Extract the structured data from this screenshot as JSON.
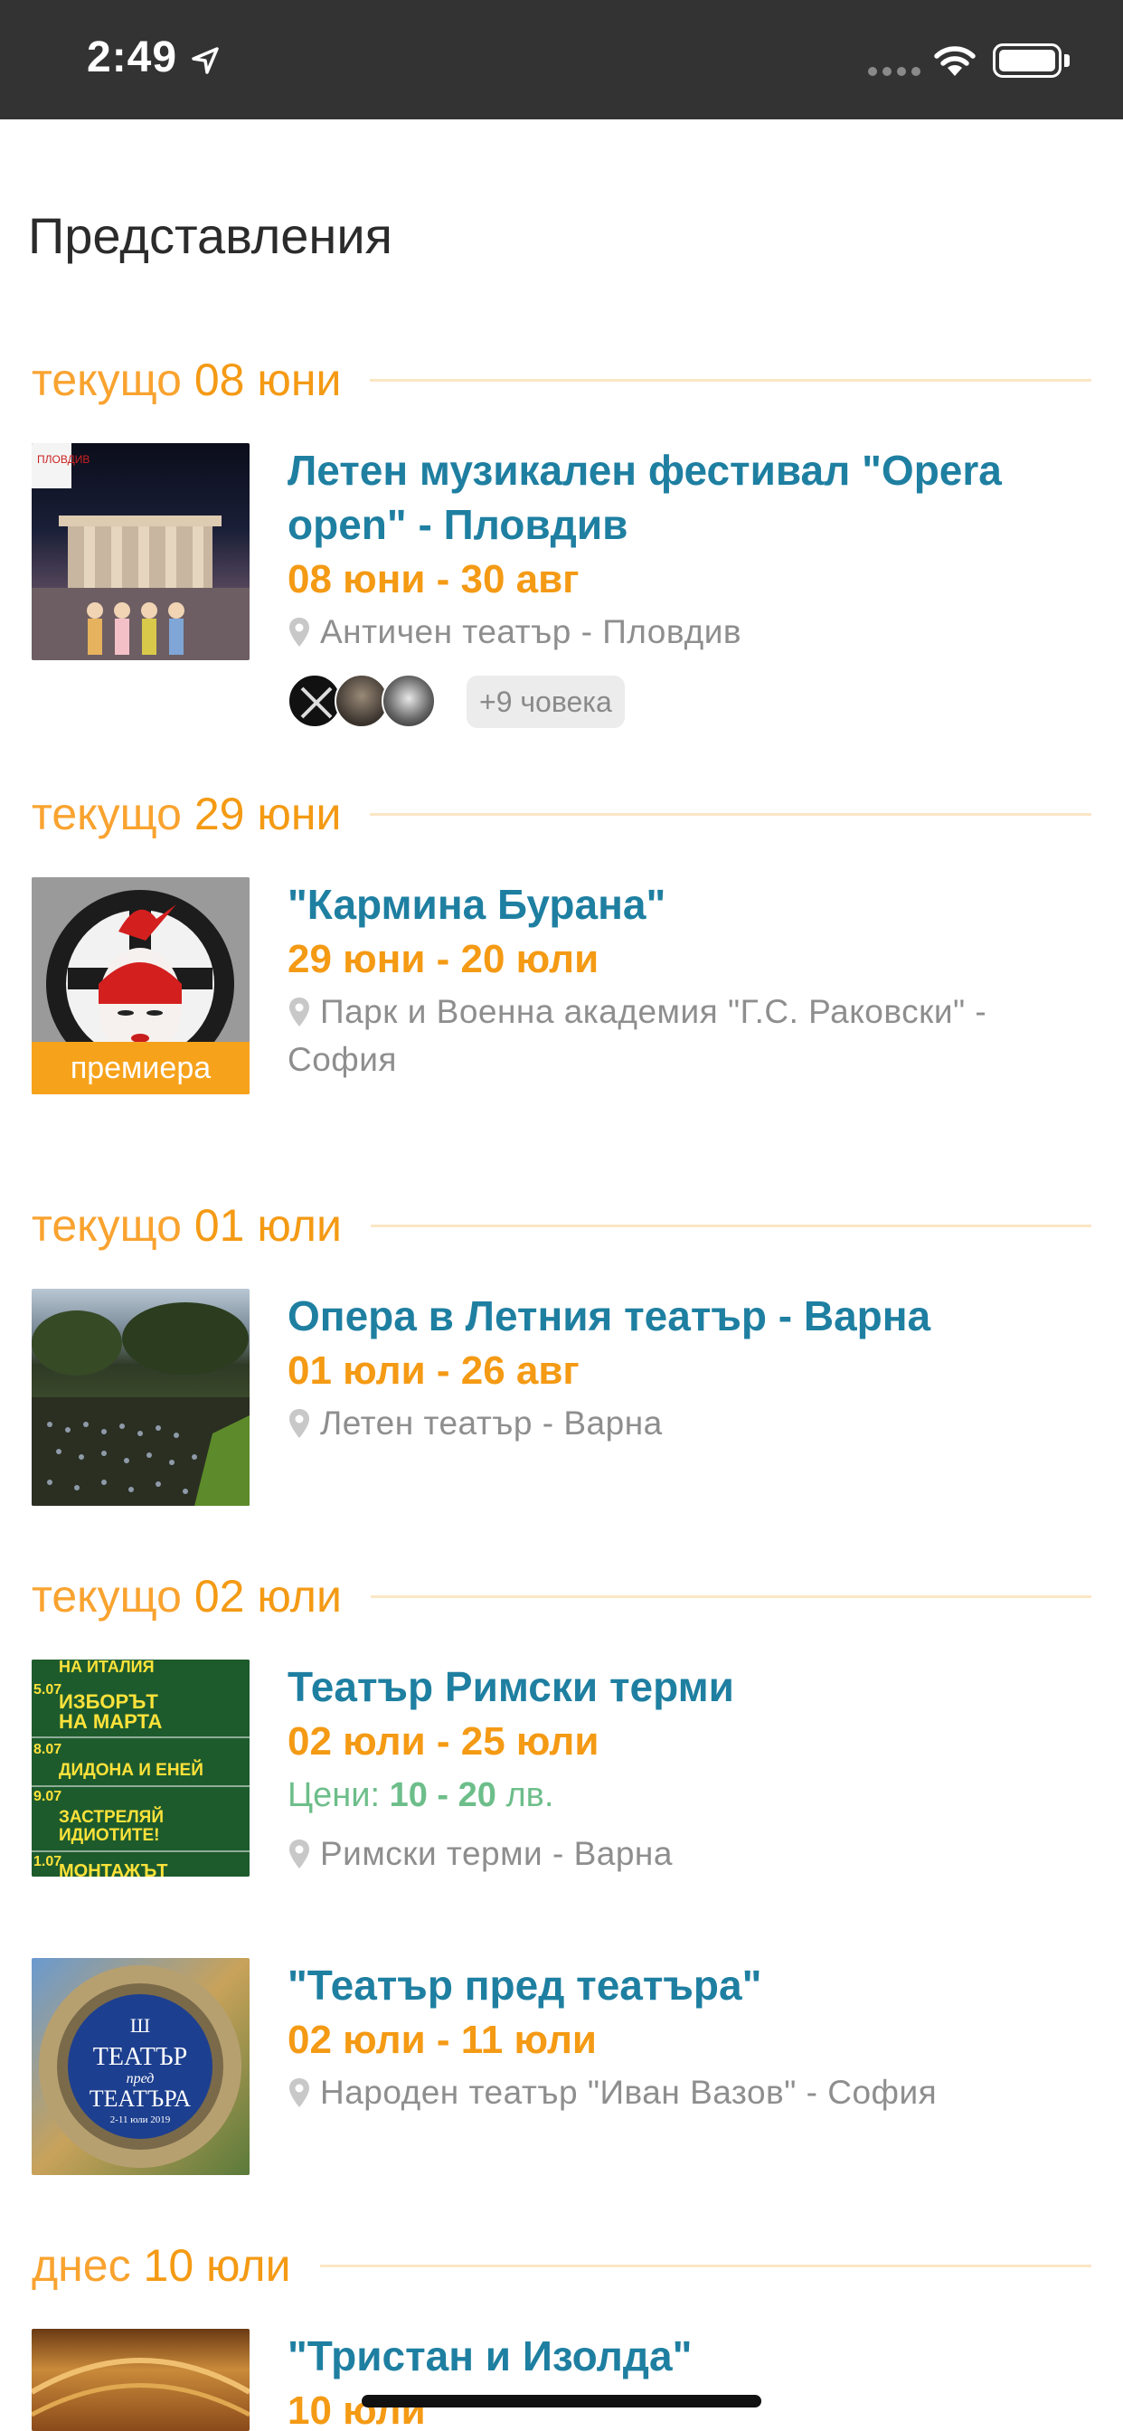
{
  "status_bar": {
    "time": "2:49"
  },
  "page": {
    "title": "Представления"
  },
  "sections": [
    {
      "prefix": "текущо",
      "date": "08 юни"
    },
    {
      "prefix": "текущо",
      "date": "29 юни"
    },
    {
      "prefix": "текущо",
      "date": "01 юли"
    },
    {
      "prefix": "текущо",
      "date": "02 юли"
    },
    {
      "prefix": "днес",
      "date": "10 юли"
    }
  ],
  "events": [
    {
      "title": "Летен музикален фестивал \"Opera open\" - Пловдив",
      "dates": "08 юни - 30 авг",
      "venue": "Античен театър - Пловдив",
      "thumb_label": "ПЛОВДИВ",
      "more_people": "+9 човека"
    },
    {
      "title": "\"Кармина Бурана\"",
      "dates": "29 юни - 20 юли",
      "venue": "Парк и Военна академия \"Г.С. Раковски\" - София",
      "badge": "премиера"
    },
    {
      "title": "Опера в Летния театър - Варна",
      "dates": "01 юли - 26 авг",
      "venue": "Летен театър - Варна"
    },
    {
      "title": "Театър Римски терми",
      "dates": "02 юли - 25 юли",
      "price_label": "Цени:",
      "price_min": "10",
      "price_sep": " - ",
      "price_max": "20",
      "price_currency": "лв.",
      "venue": "Римски терми - Варна",
      "poster_lines": [
        "НА ИТАЛИЯ",
        "5.07",
        "ИЗБОРЪТ",
        "НА МАРТА",
        "8.07",
        "ДИДОНА И ЕНЕЙ",
        "9.07",
        "ЗАСТРЕЛЯЙ",
        "ИДИОТИТЕ!",
        "1.07",
        "МОНТАЖЪТ"
      ]
    },
    {
      "title": "\"Театър пред театъра\"",
      "dates": "02 юли - 11 юли",
      "venue": "Народен театър \"Иван Вазов\" - София",
      "poster_title_1": "ТЕАТЪР",
      "poster_title_2": "пред",
      "poster_title_3": "ТЕАТЪРА",
      "poster_dates": "2-11 юли 2019"
    },
    {
      "title": "\"Тристан и Изолда\"",
      "dates": "10 юли"
    }
  ]
}
